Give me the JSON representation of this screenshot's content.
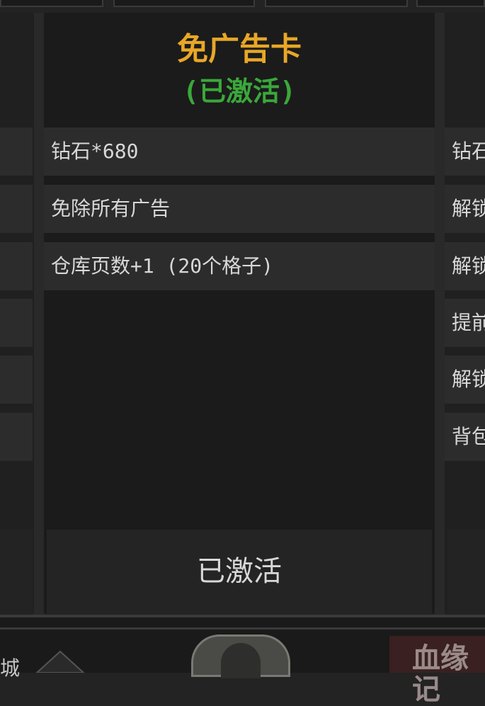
{
  "card": {
    "title": "免广告卡",
    "status": "(已激活)",
    "title_color": "#e8a727",
    "status_color": "#3aa83a",
    "features": [
      "钻石*680",
      "免除所有广告",
      "仓库页数+1 (20个格子)"
    ],
    "activate_button_label": "已激活"
  },
  "right_card": {
    "visible_row_text": [
      "钻石",
      "解锁",
      "解锁",
      "提前",
      "解锁",
      "背包"
    ]
  },
  "bottom_bar": {
    "left_partial_text": "城",
    "right_partial_text": "血缘记"
  }
}
